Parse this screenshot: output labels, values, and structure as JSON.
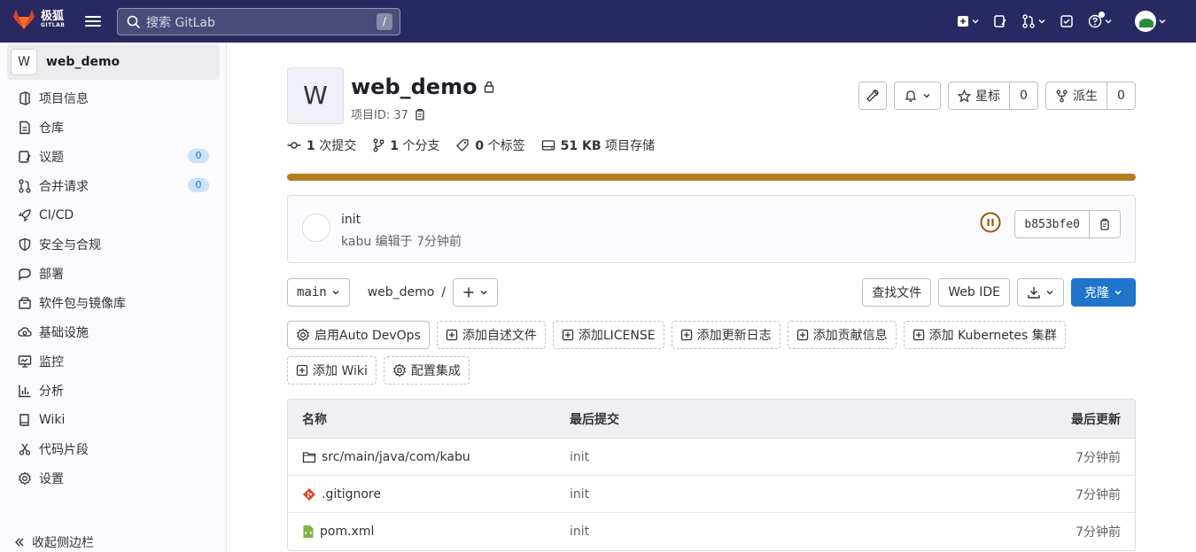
{
  "topbar": {
    "logo_cn": "极狐",
    "logo_en": "GITLAB",
    "search_placeholder": "搜索 GitLab",
    "search_shortcut": "/"
  },
  "sidebar": {
    "project_initial": "W",
    "project_name": "web_demo",
    "items": [
      {
        "label": "项目信息",
        "icon": "project-info-icon"
      },
      {
        "label": "仓库",
        "icon": "repository-icon"
      },
      {
        "label": "议题",
        "icon": "issues-icon",
        "badge": "0"
      },
      {
        "label": "合并请求",
        "icon": "merge-request-icon",
        "badge": "0"
      },
      {
        "label": "CI/CD",
        "icon": "rocket-icon"
      },
      {
        "label": "安全与合规",
        "icon": "shield-icon"
      },
      {
        "label": "部署",
        "icon": "deploy-icon"
      },
      {
        "label": "软件包与镜像库",
        "icon": "package-icon"
      },
      {
        "label": "基础设施",
        "icon": "cloud-gear-icon"
      },
      {
        "label": "监控",
        "icon": "monitor-icon"
      },
      {
        "label": "分析",
        "icon": "chart-icon"
      },
      {
        "label": "Wiki",
        "icon": "book-icon"
      },
      {
        "label": "代码片段",
        "icon": "scissors-icon"
      },
      {
        "label": "设置",
        "icon": "settings-icon"
      }
    ],
    "collapse_label": "收起侧边栏"
  },
  "project": {
    "initial": "W",
    "name": "web_demo",
    "id_label": "项目ID: 37",
    "star_label": "星标",
    "star_count": "0",
    "fork_label": "派生",
    "fork_count": "0"
  },
  "stats": {
    "commits_num": "1",
    "commits_label": "次提交",
    "branches_num": "1",
    "branches_label": "个分支",
    "tags_num": "0",
    "tags_label": "个标签",
    "storage_num": "51 KB",
    "storage_label": "项目存储"
  },
  "storage_progress": 1.0,
  "commit": {
    "title": "init",
    "meta": "kabu 编辑于 7分钟前",
    "sha": "b853bfe0"
  },
  "toolbar": {
    "branch": "main",
    "breadcrumb_root": "web_demo",
    "breadcrumb_sep": "/",
    "find_file": "查找文件",
    "web_ide": "Web IDE",
    "clone": "克隆"
  },
  "quick_actions": [
    {
      "label": "启用Auto DevOps",
      "icon": "settings-icon",
      "style": "solid"
    },
    {
      "label": "添加自述文件",
      "icon": "plus-square-icon",
      "style": "dashed"
    },
    {
      "label": "添加LICENSE",
      "icon": "plus-square-icon",
      "style": "dashed"
    },
    {
      "label": "添加更新日志",
      "icon": "plus-square-icon",
      "style": "dashed"
    },
    {
      "label": "添加贡献信息",
      "icon": "plus-square-icon",
      "style": "dashed"
    },
    {
      "label": "添加 Kubernetes 集群",
      "icon": "plus-square-icon",
      "style": "dashed"
    },
    {
      "label": "添加 Wiki",
      "icon": "plus-square-icon",
      "style": "dashed"
    },
    {
      "label": "配置集成",
      "icon": "settings-icon",
      "style": "dashed"
    }
  ],
  "files": {
    "headers": {
      "name": "名称",
      "commit": "最后提交",
      "updated": "最后更新"
    },
    "rows": [
      {
        "name": "src/main/java/com/kabu",
        "type": "folder",
        "commit": "init",
        "updated": "7分钟前"
      },
      {
        "name": ".gitignore",
        "type": "git",
        "commit": "init",
        "updated": "7分钟前"
      },
      {
        "name": "pom.xml",
        "type": "xml",
        "commit": "init",
        "updated": "7分钟前"
      }
    ]
  },
  "colors": {
    "topbar": "#292961",
    "accent": "#1f75cb",
    "storage_bar": "#b37c1e",
    "pipeline": "#9e5400"
  }
}
